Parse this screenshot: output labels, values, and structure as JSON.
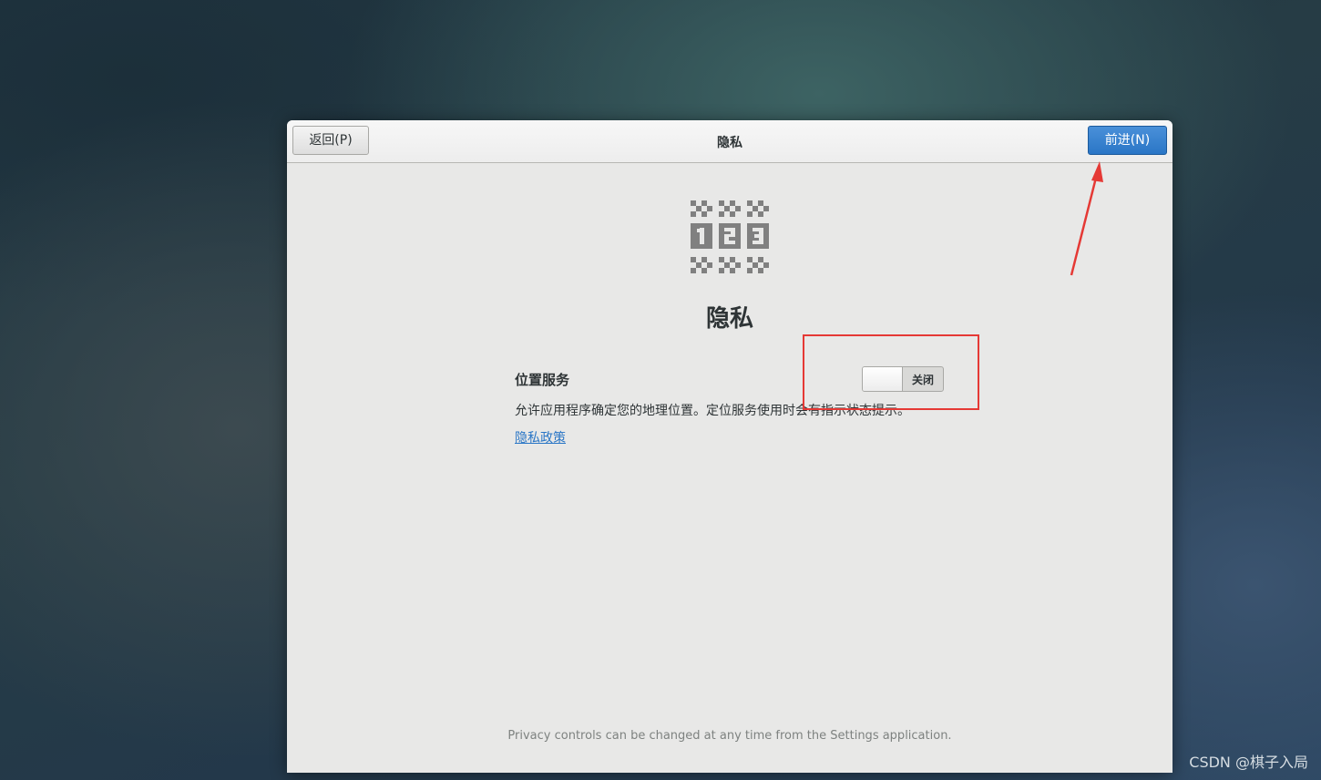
{
  "headerbar": {
    "back_label": "返回(P)",
    "title": "隐私",
    "next_label": "前进(N)"
  },
  "page": {
    "icon": "privacy-123-icon",
    "heading": "隐私"
  },
  "location_services": {
    "title": "位置服务",
    "description": "允许应用程序确定您的地理位置。定位服务使用时会有指示状态提示。",
    "switch_state_label": "关闭",
    "switch_on": false
  },
  "policy_link": "隐私政策",
  "footer_note": "Privacy controls can be changed at any time from the Settings application.",
  "annotations": {
    "highlight_box_color": "#e53935",
    "arrow_color": "#e53935"
  },
  "watermark": "CSDN @棋子入局",
  "colors": {
    "accent": "#2a76c6",
    "window_bg": "#e8e8e7"
  }
}
